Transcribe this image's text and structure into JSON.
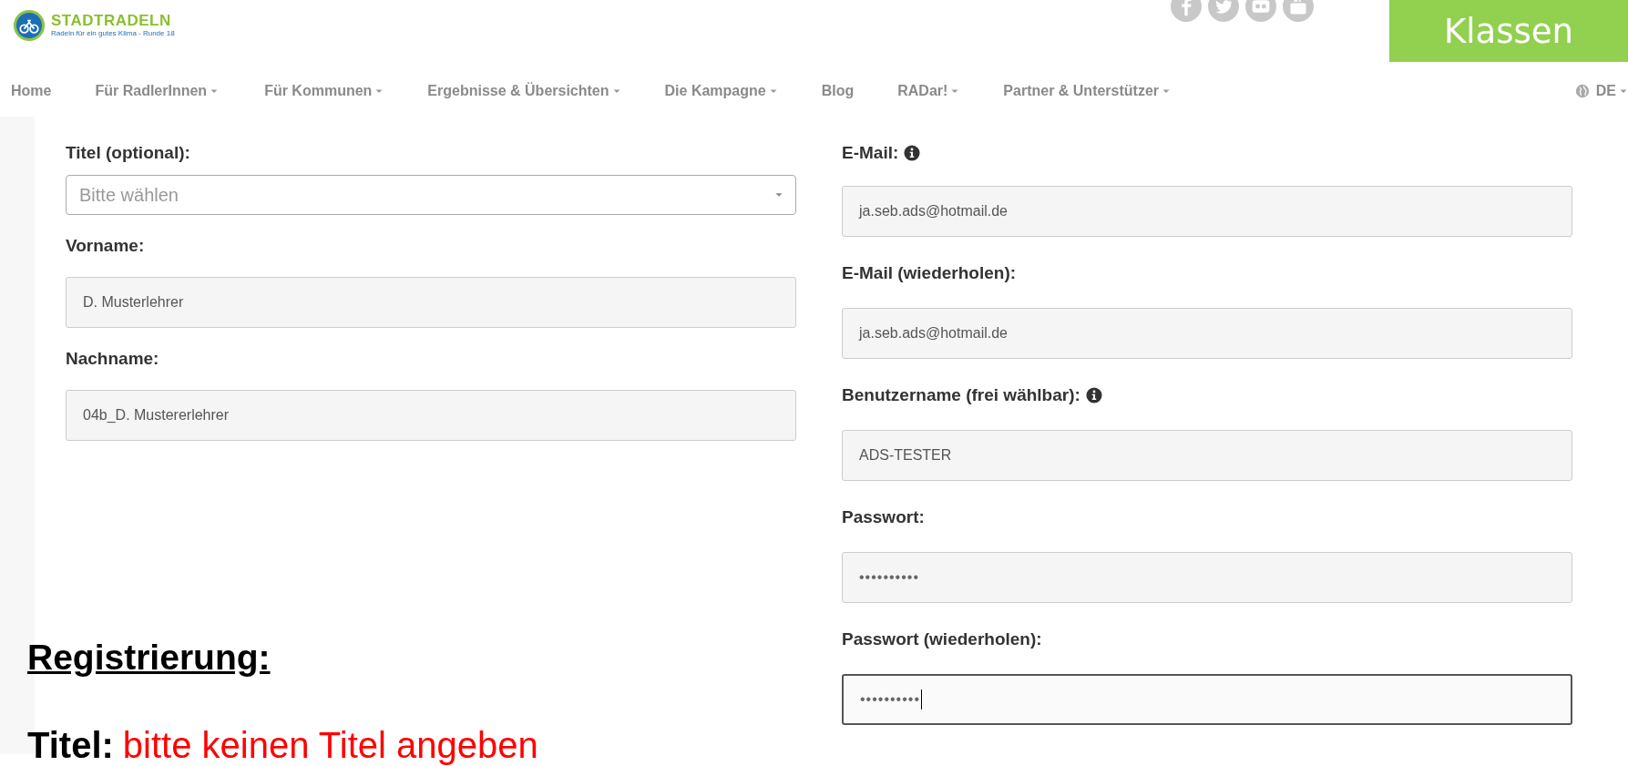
{
  "header": {
    "logo": {
      "name": "STADTRADELN",
      "tagline": "Radeln für ein gutes Klima - Runde 18"
    },
    "social": [
      {
        "kind": "facebook"
      },
      {
        "kind": "twitter"
      },
      {
        "kind": "flickr"
      },
      {
        "kind": "youtube"
      }
    ],
    "badge": "Klassen"
  },
  "nav": {
    "items": [
      {
        "label": "Home",
        "dropdown": false
      },
      {
        "label": "Für RadlerInnen",
        "dropdown": true
      },
      {
        "label": "Für Kommunen",
        "dropdown": true
      },
      {
        "label": "Ergebnisse & Übersichten",
        "dropdown": true
      },
      {
        "label": "Die Kampagne",
        "dropdown": true
      },
      {
        "label": "Blog",
        "dropdown": false
      },
      {
        "label": "RADar!",
        "dropdown": true
      },
      {
        "label": "Partner & Unterstützer",
        "dropdown": true
      }
    ],
    "language": "DE"
  },
  "form": {
    "left": [
      {
        "label": "Titel (optional):",
        "kind": "select",
        "placeholder": "Bitte wählen",
        "info": false,
        "focused": false
      },
      {
        "label": "Vorname:",
        "kind": "text",
        "value": "D. Musterlehrer",
        "info": false,
        "focused": false
      },
      {
        "label": "Nachname:",
        "kind": "text",
        "value": "04b_D. Mustererlehrer",
        "info": false,
        "focused": false
      }
    ],
    "right": [
      {
        "label": "E-Mail:",
        "kind": "text",
        "value": "ja.seb.ads@hotmail.de",
        "info": true,
        "focused": false
      },
      {
        "label": "E-Mail (wiederholen):",
        "kind": "text",
        "value": "ja.seb.ads@hotmail.de",
        "info": false,
        "focused": false
      },
      {
        "label": "Benutzername (frei wählbar):",
        "kind": "text",
        "value": "ADS-TESTER",
        "info": true,
        "focused": false
      },
      {
        "label": "Passwort:",
        "kind": "password",
        "value": "••••••••••",
        "info": false,
        "focused": false
      },
      {
        "label": "Passwort (wiederholen):",
        "kind": "password",
        "value": "••••••••••",
        "info": false,
        "focused": true
      }
    ]
  },
  "annotation": {
    "heading": "Registrierung:",
    "line_label": "Titel:",
    "line_text": "bitte keinen Titel angeben"
  }
}
